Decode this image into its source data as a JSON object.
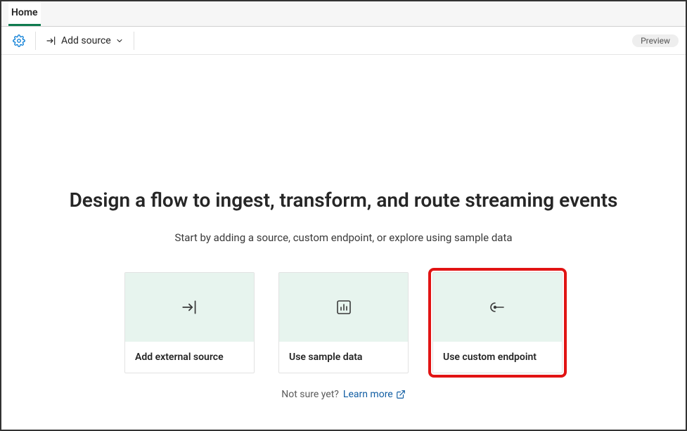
{
  "tabs": {
    "home": "Home"
  },
  "toolbar": {
    "add_source_label": "Add source",
    "preview_label": "Preview"
  },
  "hero": {
    "title": "Design a flow to ingest, transform, and route streaming events",
    "subtitle": "Start by adding a source, custom endpoint, or explore using sample data"
  },
  "cards": {
    "external": {
      "label": "Add external source"
    },
    "sample": {
      "label": "Use sample data"
    },
    "custom": {
      "label": "Use custom endpoint"
    }
  },
  "learn": {
    "prompt": "Not sure yet?",
    "link_label": "Learn more"
  }
}
